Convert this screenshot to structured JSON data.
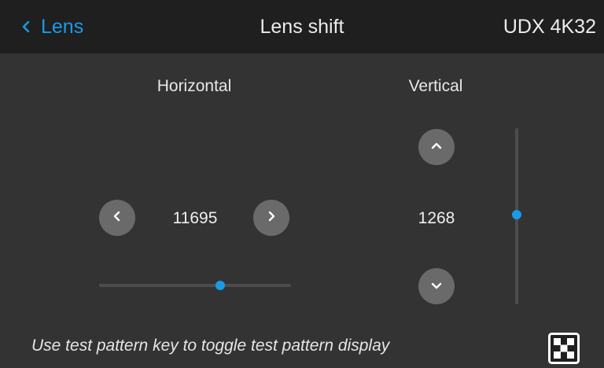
{
  "header": {
    "back_label": "Lens",
    "title": "Lens shift",
    "model": "UDX 4K32"
  },
  "horizontal": {
    "label": "Horizontal",
    "value": "11695",
    "position": 0.63
  },
  "vertical": {
    "label": "Vertical",
    "value": "1268",
    "position": 0.51
  },
  "footer": {
    "hint": "Use test pattern key to toggle test pattern display"
  },
  "icons": {
    "back": "chevron-left-icon",
    "left": "chevron-left-icon",
    "right": "chevron-right-icon",
    "up": "chevron-up-icon",
    "down": "chevron-down-icon",
    "pattern": "test-pattern-icon"
  },
  "colors": {
    "accent": "#1a9be8",
    "background": "#333333",
    "header": "#1f1f1f",
    "button": "#6a6a6a"
  }
}
